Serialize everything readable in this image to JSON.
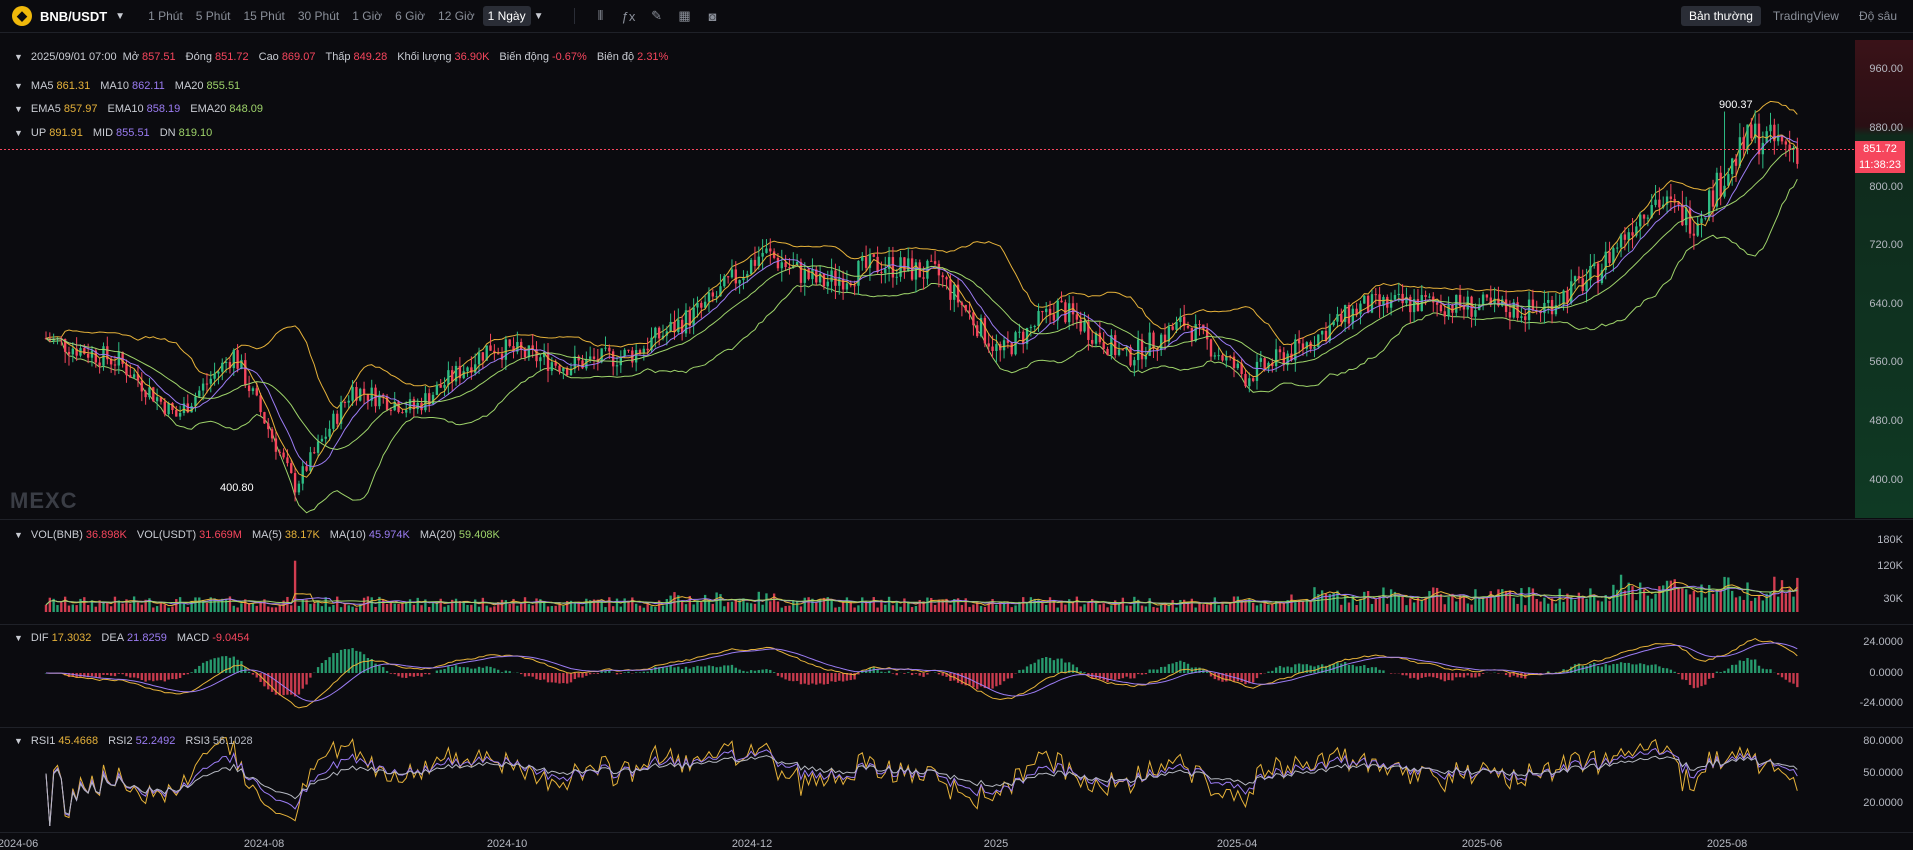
{
  "toolbar": {
    "pair": "BNB/USDT",
    "timeframes": [
      "1 Phút",
      "5 Phút",
      "15 Phút",
      "30 Phút",
      "1 Giờ",
      "6 Giờ",
      "12 Giờ",
      "1 Ngày"
    ],
    "active_timeframe": "1 Ngày",
    "views": [
      "Bản thường",
      "TradingView",
      "Độ sâu"
    ],
    "active_view": "Bản thường",
    "icons": [
      "candles-icon",
      "formula-icon",
      "pencil-icon",
      "layout-grid-icon",
      "camera-icon"
    ]
  },
  "ohlc": {
    "date": "2025/09/01 07:00",
    "open_label": "Mở",
    "open": "857.51",
    "close_label": "Đóng",
    "close": "851.72",
    "high_label": "Cao",
    "high": "869.07",
    "low_label": "Thấp",
    "low": "849.28",
    "volume_label": "Khối lượng",
    "volume": "36.90K",
    "change_label": "Biến động",
    "change": "-0.67%",
    "amplitude_label": "Biên độ",
    "amplitude": "2.31%"
  },
  "ma": {
    "ma5_label": "MA5",
    "ma5": "861.31",
    "ma10_label": "MA10",
    "ma10": "862.11",
    "ma20_label": "MA20",
    "ma20": "855.51"
  },
  "ema": {
    "ema5_label": "EMA5",
    "ema5": "857.97",
    "ema10_label": "EMA10",
    "ema10": "858.19",
    "ema20_label": "EMA20",
    "ema20": "848.09"
  },
  "boll": {
    "up_label": "UP",
    "up": "891.91",
    "mid_label": "MID",
    "mid": "855.51",
    "dn_label": "DN",
    "dn": "819.10"
  },
  "vol": {
    "bnb_label": "VOL(BNB)",
    "bnb": "36.898K",
    "usdt_label": "VOL(USDT)",
    "usdt": "31.669M",
    "ma5_label": "MA(5)",
    "ma5": "38.17K",
    "ma10_label": "MA(10)",
    "ma10": "45.974K",
    "ma20_label": "MA(20)",
    "ma20": "59.408K"
  },
  "macd": {
    "dif_label": "DIF",
    "dif": "17.3032",
    "dea_label": "DEA",
    "dea": "21.8259",
    "macd_label": "MACD",
    "macd": "-9.0454"
  },
  "rsi": {
    "rsi1_label": "RSI1",
    "rsi1": "45.4668",
    "rsi2_label": "RSI2",
    "rsi2": "52.2492",
    "rsi3_label": "RSI3",
    "rsi3": "56.1028"
  },
  "price_axis": [
    "960.00",
    "880.00",
    "800.00",
    "720.00",
    "640.00",
    "560.00",
    "480.00",
    "400.00"
  ],
  "vol_axis": [
    "180K",
    "120K",
    "30K"
  ],
  "macd_axis": [
    "24.0000",
    "0.0000",
    "-24.0000"
  ],
  "rsi_axis": [
    "80.0000",
    "50.0000",
    "20.0000"
  ],
  "time_axis": [
    "2024-06",
    "2024-08",
    "2024-10",
    "2024-12",
    "2025",
    "2025-04",
    "2025-06",
    "2025-08"
  ],
  "last_price": "851.72",
  "countdown": "11:38:23",
  "high_annotation": "900.37",
  "low_annotation": "400.80",
  "watermark": "MEXC",
  "colors": {
    "up": "#2ebd85",
    "down": "#f6465d",
    "ma5": "#e6b23a",
    "ma10": "#9b7cf3",
    "ma20": "#9ed36a",
    "background": "#0b0b0f"
  },
  "chart_data": {
    "type": "candlestick",
    "symbol": "BNB/USDT",
    "interval": "1 Ngày",
    "x_range": [
      "2024-06",
      "2025-09-01"
    ],
    "ylim": [
      400,
      960
    ],
    "price_path": [
      [
        "2024-06",
        610
      ],
      [
        "2024-06-20",
        580
      ],
      [
        "2024-07-05",
        510
      ],
      [
        "2024-07-20",
        590
      ],
      [
        "2024-08-05",
        420
      ],
      [
        "2024-08-20",
        545
      ],
      [
        "2024-09-05",
        520
      ],
      [
        "2024-09-25",
        600
      ],
      [
        "2024-10-15",
        575
      ],
      [
        "2024-11-01",
        590
      ],
      [
        "2024-11-20",
        650
      ],
      [
        "2024-12-05",
        720
      ],
      [
        "2024-12-20",
        680
      ],
      [
        "2025-01-05",
        705
      ],
      [
        "2025-01-20",
        690
      ],
      [
        "2025-02-05",
        590
      ],
      [
        "2025-02-20",
        650
      ],
      [
        "2025-03-10",
        585
      ],
      [
        "2025-03-25",
        630
      ],
      [
        "2025-04-10",
        560
      ],
      [
        "2025-04-25",
        600
      ],
      [
        "2025-05-10",
        650
      ],
      [
        "2025-05-25",
        655
      ],
      [
        "2025-06-10",
        650
      ],
      [
        "2025-06-25",
        645
      ],
      [
        "2025-07-10",
        690
      ],
      [
        "2025-07-25",
        790
      ],
      [
        "2025-08-05",
        760
      ],
      [
        "2025-08-20",
        870
      ],
      [
        "2025-09-01",
        851.72
      ]
    ],
    "high": 900.37,
    "low": 400.8,
    "last": 851.72,
    "indicators": [
      "MA5",
      "MA10",
      "MA20",
      "EMA5",
      "EMA10",
      "EMA20",
      "BOLL",
      "VOL",
      "MACD",
      "RSI"
    ]
  }
}
